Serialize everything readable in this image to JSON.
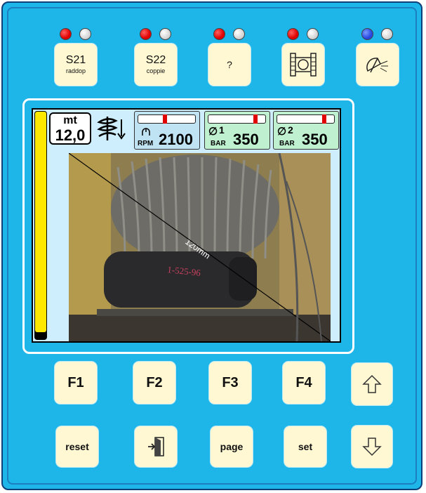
{
  "top_keys": [
    {
      "label": "S21",
      "sub": "raddop",
      "leds": [
        "red",
        "grey"
      ]
    },
    {
      "label": "S22",
      "sub": "coppie",
      "leds": [
        "red",
        "grey"
      ]
    },
    {
      "label": "?",
      "sub": "",
      "leds": [
        "red",
        "grey"
      ]
    },
    {
      "icon": "winch-drum-icon",
      "leds": [
        "red",
        "grey"
      ]
    },
    {
      "icon": "work-light-icon",
      "leds": [
        "blue",
        "grey"
      ]
    }
  ],
  "display": {
    "length_unit": "mt",
    "length_value": "12,0",
    "level_fraction": 0.97,
    "rpm": {
      "unit": "RPM",
      "value": "2100",
      "bar_fraction": 0.48
    },
    "pressure1": {
      "index": "1",
      "unit": "BAR",
      "value": "350",
      "bar_fraction": 0.88
    },
    "pressure2": {
      "index": "2",
      "unit": "BAR",
      "value": "350",
      "bar_fraction": 0.88
    },
    "photo_caption": "120mm",
    "photo_handwriting": "1-525-96"
  },
  "function_keys": [
    "F1",
    "F2",
    "F3",
    "F4"
  ],
  "bottom_keys": {
    "reset": "reset",
    "page": "page",
    "set": "set"
  },
  "arrow_icons": [
    "arrow-up-icon",
    "arrow-down-icon"
  ],
  "colors": {
    "panel": "#1eb5e8",
    "key": "#fff8d2",
    "level": "#ffe800",
    "marker": "#e00000"
  }
}
